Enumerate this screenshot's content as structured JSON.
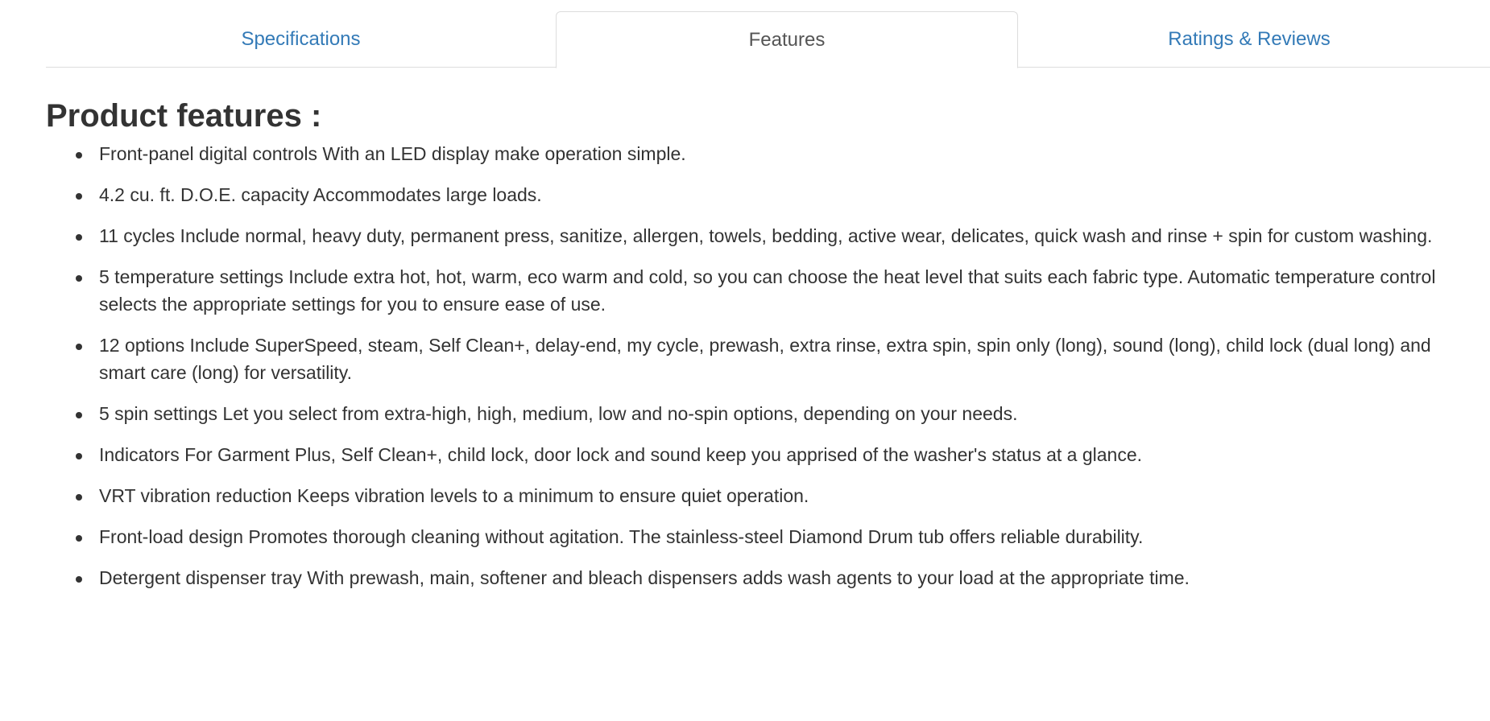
{
  "tabs": [
    {
      "label": "Specifications",
      "active": false
    },
    {
      "label": "Features",
      "active": true
    },
    {
      "label": "Ratings & Reviews",
      "active": false
    }
  ],
  "section": {
    "title": "Product features :"
  },
  "features": [
    "Front-panel digital controls With an LED display make operation simple.",
    "4.2 cu. ft. D.O.E. capacity Accommodates large loads.",
    "11 cycles Include normal, heavy duty, permanent press, sanitize, allergen, towels, bedding, active wear, delicates, quick wash and rinse + spin for custom washing.",
    "5 temperature settings Include extra hot, hot, warm, eco warm and cold, so you can choose the heat level that suits each fabric type. Automatic temperature control selects the appropriate settings for you to ensure ease of use.",
    "12 options Include SuperSpeed, steam, Self Clean+, delay-end, my cycle, prewash, extra rinse, extra spin, spin only (long), sound (long), child lock (dual long) and smart care (long) for versatility.",
    "5 spin settings Let you select from extra-high, high, medium, low and no-spin options, depending on your needs.",
    "Indicators For Garment Plus, Self Clean+, child lock, door lock and sound keep you apprised of the washer's status at a glance.",
    "VRT vibration reduction Keeps vibration levels to a minimum to ensure quiet operation.",
    "Front-load design Promotes thorough cleaning without agitation. The stainless-steel Diamond Drum tub offers reliable durability.",
    "Detergent dispenser tray With prewash, main, softener and bleach dispensers adds wash agents to your load at the appropriate time."
  ],
  "colors": {
    "link": "#337ab7",
    "text": "#333333",
    "border": "#dddddd"
  }
}
